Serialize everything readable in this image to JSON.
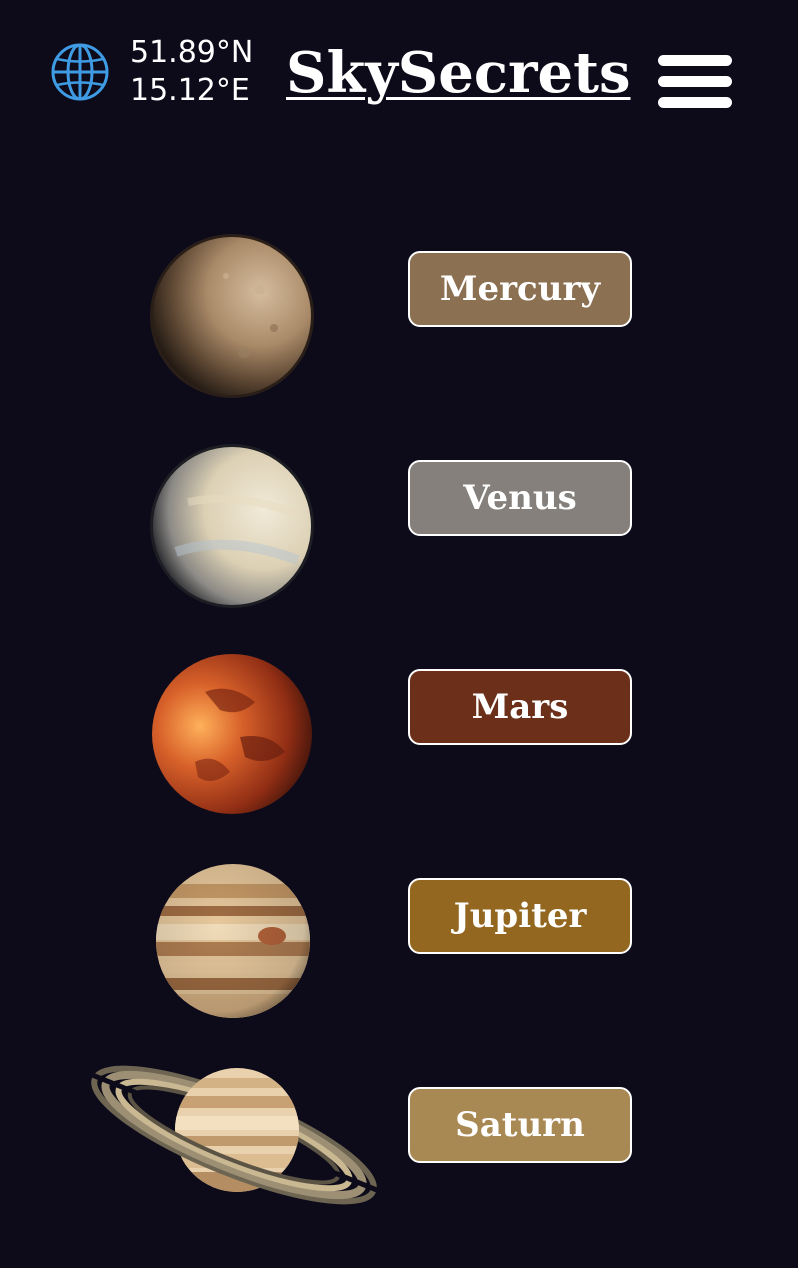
{
  "header": {
    "latitude": "51.89°N",
    "longitude": "15.12°E",
    "brand": "SkySecrets",
    "globe_icon": "globe-icon",
    "menu_icon": "hamburger-menu-icon"
  },
  "planets": [
    {
      "name": "Mercury",
      "color": "#8c7052"
    },
    {
      "name": "Venus",
      "color": "#85807b"
    },
    {
      "name": "Mars",
      "color": "#6c2f19"
    },
    {
      "name": "Jupiter",
      "color": "#93671f"
    },
    {
      "name": "Saturn",
      "color": "#a88853"
    }
  ],
  "colors": {
    "background": "#0d0b1a",
    "globe": "#3f9be3"
  }
}
